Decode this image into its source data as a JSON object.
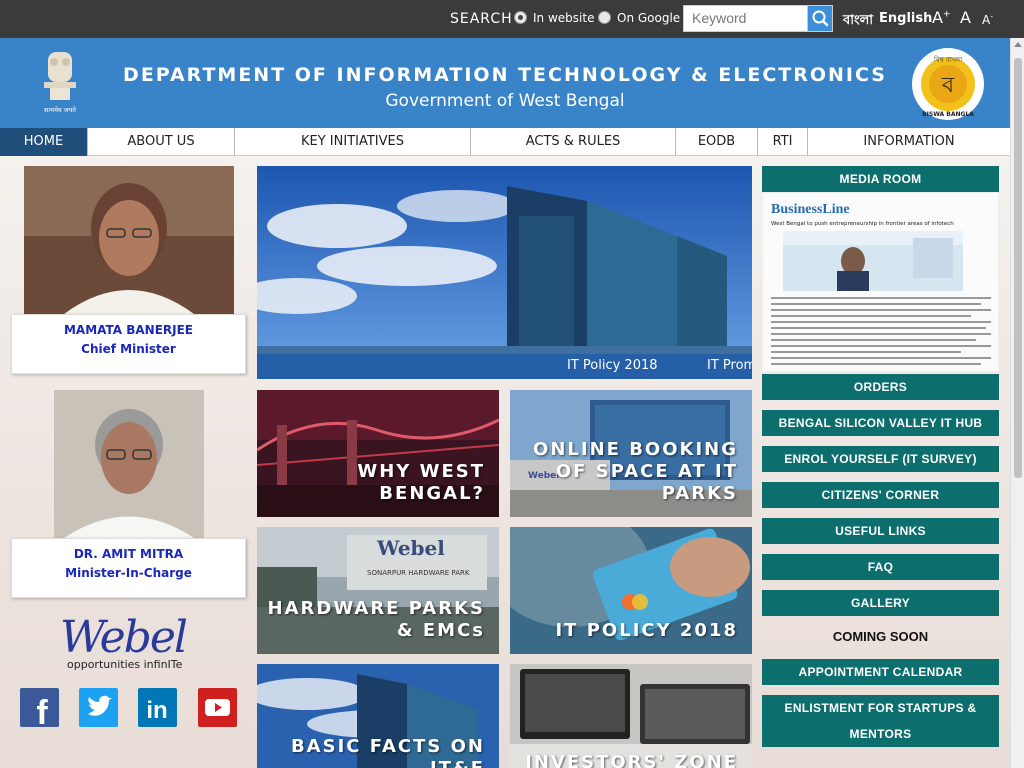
{
  "topbar": {
    "search_label": "SEARCH",
    "option_website": "In website",
    "option_google": "On Google",
    "keyword_placeholder": "Keyword",
    "lang_bangla": "বাংলা",
    "lang_english": "English",
    "font_increase": "A+",
    "font_normal": "A",
    "font_decrease": "A-"
  },
  "header": {
    "title": "DEPARTMENT OF INFORMATION TECHNOLOGY & ELECTRONICS",
    "subtitle": "Government of West Bengal",
    "emblem_motto": "सत्यमेव जयते",
    "logo_text": "BISWA BANGLA",
    "logo_top_text": "বিশ্ব বাংলা"
  },
  "nav": {
    "items": [
      {
        "label": "HOME",
        "active": true
      },
      {
        "label": "ABOUT US"
      },
      {
        "label": "KEY INITIATIVES"
      },
      {
        "label": "ACTS & RULES"
      },
      {
        "label": "EODB"
      },
      {
        "label": "RTI"
      },
      {
        "label": "INFORMATION"
      }
    ]
  },
  "leaders": [
    {
      "name": "MAMATA BANERJEE",
      "role": "Chief Minister"
    },
    {
      "name": "DR. AMIT MITRA",
      "role": "Minister-In-Charge"
    }
  ],
  "webel": {
    "word": "Webel",
    "tagline": "opportunities infinITe"
  },
  "social": [
    {
      "icon": "facebook-icon",
      "glyph": "f",
      "color": "#3b5998"
    },
    {
      "icon": "twitter-icon",
      "glyph": "🐦",
      "color": "#1da1f2"
    },
    {
      "icon": "linkedin-icon",
      "glyph": "in",
      "color": "#0077b5"
    },
    {
      "icon": "youtube-icon",
      "glyph": "▶",
      "color": "#cd201f"
    }
  ],
  "slider": {
    "captions": [
      "IT Policy 2018",
      "IT Prom"
    ]
  },
  "tiles": [
    {
      "label": "WHY WEST\nBENGAL?"
    },
    {
      "label": "ONLINE BOOKING\nOF SPACE AT IT\nPARKS"
    },
    {
      "label": "HARDWARE PARKS\n& EMCs"
    },
    {
      "label": "IT POLICY 2018"
    },
    {
      "label": "BASIC FACTS ON\nIT&E"
    },
    {
      "label": "INVESTORS' ZONE"
    }
  ],
  "tile_signs": {
    "webel_sign": "Webel",
    "park_sign": "SONARPUR HARDWARE PARK"
  },
  "right": {
    "media_room": "MEDIA ROOM",
    "media_masthead": "BusinessLine",
    "media_headline": "West Bengal to push entrepreneurship in frontier areas of infotech",
    "buttons": [
      "ORDERS",
      "BENGAL SILICON VALLEY IT HUB",
      "ENROL YOURSELF (IT SURVEY)",
      "CITIZENS' CORNER",
      "USEFUL LINKS",
      "FAQ",
      "GALLERY"
    ],
    "coming_soon": "COMING SOON",
    "appointment": "APPOINTMENT CALENDAR",
    "enlistment": "ENLISTMENT FOR STARTUPS & MENTORS"
  },
  "colors": {
    "header_blue": "#3983c8",
    "teal": "#0d6e6e",
    "nav_active": "#1e4e79",
    "topbar": "#3b3b3b"
  }
}
